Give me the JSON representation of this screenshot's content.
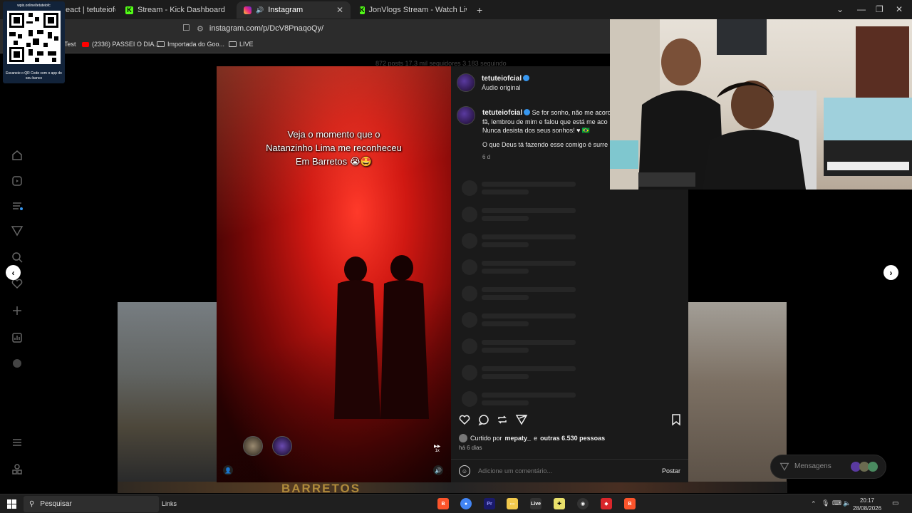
{
  "browser": {
    "tabs": [
      {
        "label": "eact | tetuteiofc"
      },
      {
        "label": "Stream - Kick Dashboard"
      },
      {
        "label": "Instagram"
      },
      {
        "label": "JonVlogs Stream - Watch Live on Kic"
      }
    ],
    "new_tab": "+",
    "url": "instagram.com/p/DcV8PnaqoQy/",
    "bookmarks": [
      {
        "label": "Test"
      },
      {
        "label": "(2336) PASSEI O DIA..."
      },
      {
        "label": "Importada do Goo..."
      },
      {
        "label": "LIVE"
      }
    ]
  },
  "qr_overlay": {
    "url": "wpix.online/tetuteiofc",
    "caption": "Escaneie o QR Code com o app do seu banco"
  },
  "background_profile": {
    "stats": "872 posts   17,3 mil seguidores   3.183 seguindo",
    "bottom_thumb_text": "BARRETOS"
  },
  "reel": {
    "caption_lines": [
      "Veja o momento que o",
      "Natanzinho Lima me reconheceu",
      "Em Barretos 😭🤩"
    ],
    "speed_label": "1x"
  },
  "post": {
    "author": "tetuteiofcial",
    "audio": "Áudio original",
    "caption_author": "tetuteiofcial",
    "caption_line1": "Se for sonho, não me acord",
    "caption_line2": "fã, lembrou de mim e falou que está me aco",
    "caption_line3": "Nunca desista dos seus sonhos! ♥ 🇧🇷",
    "caption_line4": "O que Deus tá fazendo esse comigo é surre",
    "caption_time": "6 d",
    "likes_prefix": "Curtido por",
    "likes_user": "mepaty_",
    "likes_middle": "e",
    "likes_others": "outras 6.530 pessoas",
    "posted_ago": "há 6 dias",
    "comment_placeholder": "Adicione um comentário...",
    "post_button": "Postar"
  },
  "messages": {
    "label": "Mensagens"
  },
  "taskbar": {
    "search_placeholder": "Pesquisar",
    "links": "Links",
    "time": "20:17",
    "date": "28/08/2026"
  },
  "colors": {
    "kick_green": "#53fc18",
    "ig_blue": "#3797f0",
    "modal_panel": "#1a1a1a",
    "reel_red": "#d01812"
  }
}
